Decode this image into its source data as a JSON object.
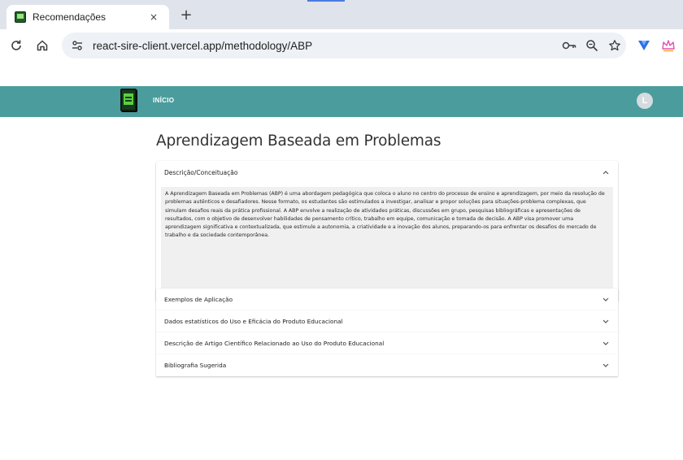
{
  "browser": {
    "tab_title": "Recomendações",
    "tab_close_glyph": "×",
    "new_tab_glyph": "+",
    "url": "react-sire-client.vercel.app/methodology/ABP",
    "icons": [
      "back-arrow-icon",
      "home-icon",
      "site-settings-icon",
      "password-key-icon",
      "zoom-icon",
      "bookmark-star-icon",
      "extension-v-icon",
      "extension-crown-icon"
    ]
  },
  "header": {
    "nav_inicio": "INÍCIO",
    "avatar_letter": "L",
    "colors": {
      "header_bg": "#4a9d9c",
      "logo_green": "#5ccf3f"
    }
  },
  "main": {
    "title": "Aprendizagem Baseada em Problemas",
    "accordions": [
      {
        "label": "Descrição/Conceituação",
        "expanded": true,
        "body": "A Aprendizagem Baseada em Problemas (ABP) é uma abordagem pedagógica que coloca o aluno no centro do processo de ensino e aprendizagem, por meio da resolução de problemas autênticos e desafiadores. Nesse formato, os estudantes são estimulados a investigar, analisar e propor soluções para situações-problema complexas, que simulam desafios reais da prática profissional. A ABP envolve a realização de atividades práticas, discussões em grupo, pesquisas bibliográficas e apresentações de resultados, com o objetivo de desenvolver habilidades de pensamento crítico, trabalho em equipe, comunicação e tomada de decisão. A ABP visa promover uma aprendizagem significativa e contextualizada, que estimule a autonomia, a criatividade e a inovação dos alunos, preparando-os para enfrentar os desafios do mercado de trabalho e da sociedade contemporânea."
      },
      {
        "label": "Exemplos de Aplicação",
        "expanded": false
      },
      {
        "label": "Dados estatísticos do Uso e Eficácia do Produto Educacional",
        "expanded": false
      },
      {
        "label": "Descrição de Artigo Científico Relacionado ao Uso do Produto Educacional",
        "expanded": false
      },
      {
        "label": "Bibliografia Sugerida",
        "expanded": false
      }
    ]
  }
}
